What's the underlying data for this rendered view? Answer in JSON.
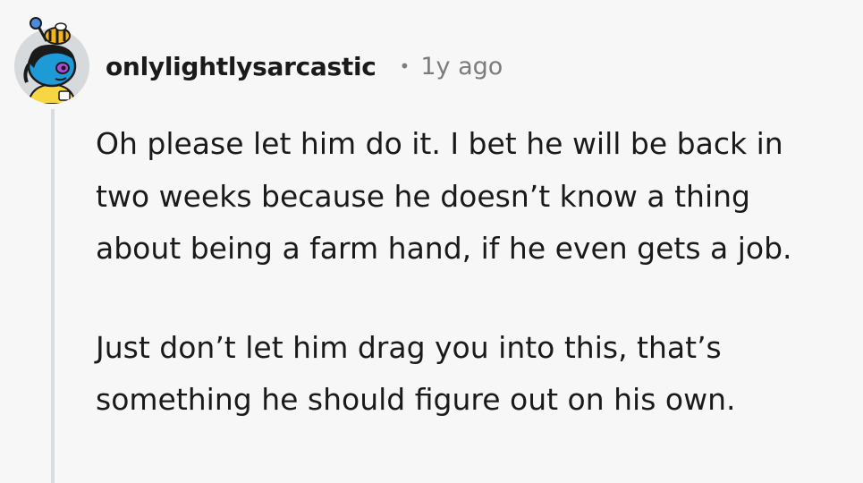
{
  "comment": {
    "username": "onlylightlysarcastic",
    "separator": "•",
    "timestamp": "1y ago",
    "paragraphs": [
      "Oh please let him do it. I bet he will be back in two weeks because he doesn’t know a thing about being a farm hand, if he even gets a job.",
      "Just don’t let him drag you into this, that’s something he should figure out on his own."
    ],
    "avatar_icon": "snoo-avatar-icon"
  }
}
